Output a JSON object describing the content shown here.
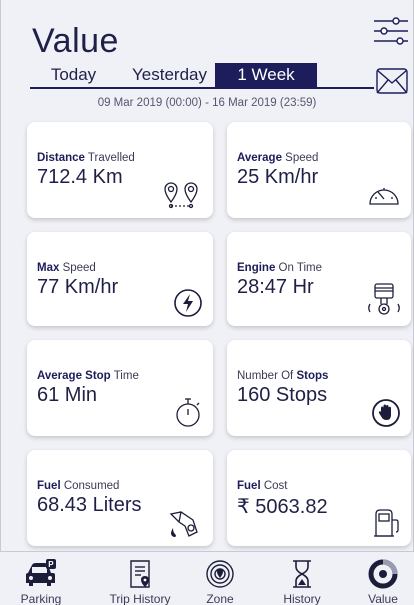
{
  "header": {
    "title": "Value",
    "filter_icon": "filter-sliders-icon",
    "mail_icon": "mail-icon"
  },
  "tabs": [
    {
      "label": "Today",
      "active": false
    },
    {
      "label": "Yesterday",
      "active": false
    },
    {
      "label": "1 Week",
      "active": true
    }
  ],
  "date_range": "09 Mar 2019 (00:00) - 16 Mar 2019 (23:59)",
  "cards": [
    {
      "bold": "Distance",
      "rest": " Travelled",
      "value": "712.4 Km",
      "icon": "location-pins-icon"
    },
    {
      "bold": "Average",
      "rest": " Speed",
      "value": "25 Km/hr",
      "icon": "speedometer-icon"
    },
    {
      "bold": "Max",
      "rest": " Speed",
      "value": "77 Km/hr",
      "icon": "lightning-circle-icon"
    },
    {
      "bold": "Engine",
      "rest": " On Time",
      "value": "28:47 Hr",
      "icon": "engine-piston-icon"
    },
    {
      "bold": "Average Stop",
      "rest": " Time",
      "value": "61 Min",
      "icon": "stopwatch-icon"
    },
    {
      "pre": "Number Of ",
      "bold": "Stops",
      "value": "160 Stops",
      "icon": "stop-hand-icon"
    },
    {
      "bold": "Fuel",
      "rest": " Consumed",
      "value": "68.43 Liters",
      "icon": "fuel-nozzle-icon"
    },
    {
      "bold": "Fuel",
      "rest": " Cost",
      "value": "₹ 5063.82",
      "icon": "fuel-pump-icon"
    }
  ],
  "nav": [
    {
      "label": "Parking",
      "icon": "car-parking-icon"
    },
    {
      "label": "Trip History",
      "icon": "trip-document-icon"
    },
    {
      "label": "Zone",
      "icon": "zone-target-icon"
    },
    {
      "label": "History",
      "icon": "hourglass-icon"
    },
    {
      "label": "Value",
      "icon": "value-gauge-icon"
    }
  ],
  "colors": {
    "primary": "#1c1d5a",
    "background": "#f0f1f6",
    "card": "#ffffff",
    "text": "#1f2048"
  }
}
